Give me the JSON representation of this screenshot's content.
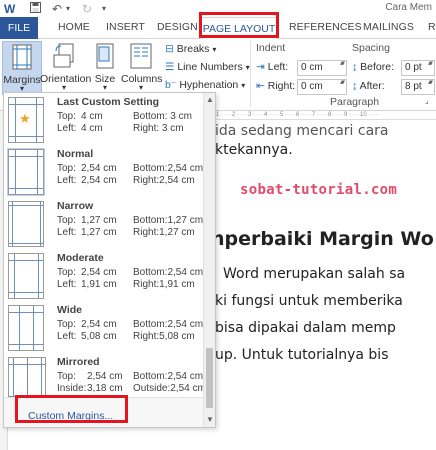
{
  "titlebar": {
    "window_title": "Cara Mem",
    "icons": [
      "word-icon",
      "save-icon",
      "undo-icon",
      "undo-dropdown-icon",
      "redo-icon",
      "customize-icon"
    ]
  },
  "tabs": {
    "file": "FILE",
    "home": "HOME",
    "insert": "INSERT",
    "design": "DESIGN",
    "page_layout": "PAGE LAYOUT",
    "references": "REFERENCES",
    "mailings": "MAILINGS",
    "r": "R"
  },
  "ribbon": {
    "margins": "Margins",
    "orientation": "Orientation",
    "size": "Size",
    "columns": "Columns",
    "breaks": "Breaks",
    "line_numbers": "Line Numbers",
    "hyphenation": "Hyphenation",
    "indent_label": "Indent",
    "indent_left_label": "Left:",
    "indent_left_value": "0 cm",
    "indent_right_label": "Right:",
    "indent_right_value": "0 cm",
    "spacing_label": "Spacing",
    "spacing_before_label": "Before:",
    "spacing_before_value": "0 pt",
    "spacing_after_label": "After:",
    "spacing_after_value": "8 pt",
    "paragraph_group": "Paragraph"
  },
  "margins_menu": {
    "items": [
      {
        "name": "Last Custom Setting",
        "top": "4 cm",
        "bottom": "3 cm",
        "left": "4 cm",
        "right": "3 cm",
        "k1": "Top:",
        "k2": "Bottom:",
        "k3": "Left:",
        "k4": "Right:"
      },
      {
        "name": "Normal",
        "top": "2,54 cm",
        "bottom": "2,54 cm",
        "left": "2,54 cm",
        "right": "2,54 cm",
        "k1": "Top:",
        "k2": "Bottom:",
        "k3": "Left:",
        "k4": "Right:"
      },
      {
        "name": "Narrow",
        "top": "1,27 cm",
        "bottom": "1,27 cm",
        "left": "1,27 cm",
        "right": "1,27 cm",
        "k1": "Top:",
        "k2": "Bottom:",
        "k3": "Left:",
        "k4": "Right:"
      },
      {
        "name": "Moderate",
        "top": "2,54 cm",
        "bottom": "2,54 cm",
        "left": "1,91 cm",
        "right": "1,91 cm",
        "k1": "Top:",
        "k2": "Bottom:",
        "k3": "Left:",
        "k4": "Right:"
      },
      {
        "name": "Wide",
        "top": "2,54 cm",
        "bottom": "2,54 cm",
        "left": "5,08 cm",
        "right": "5,08 cm",
        "k1": "Top:",
        "k2": "Bottom:",
        "k3": "Left:",
        "k4": "Right:"
      },
      {
        "name": "Mirrored",
        "top": "2,54 cm",
        "bottom": "2,54 cm",
        "left": "3,18 cm",
        "right": "2,54 cm",
        "k1": "Top:",
        "k2": "Bottom:",
        "k3": "Inside:",
        "k4": "Outside:"
      }
    ],
    "custom_margins": "Custom Margins..."
  },
  "document": {
    "line1": "ida sedang mencari cara",
    "line2": "ktekannya.",
    "watermark": "sobat-tutorial.com",
    "heading": "nperbaiki Margin Wo",
    "p1": "Word merupakan salah sa",
    "p2": "ki fungsi untuk memberika",
    "p3": " bisa dipakai dalam memp",
    "p4": "up. Untuk tutorialnya bis"
  },
  "colors": {
    "accent": "#2b579a",
    "highlight_box": "#e4151f",
    "watermark": "#e24a68"
  }
}
